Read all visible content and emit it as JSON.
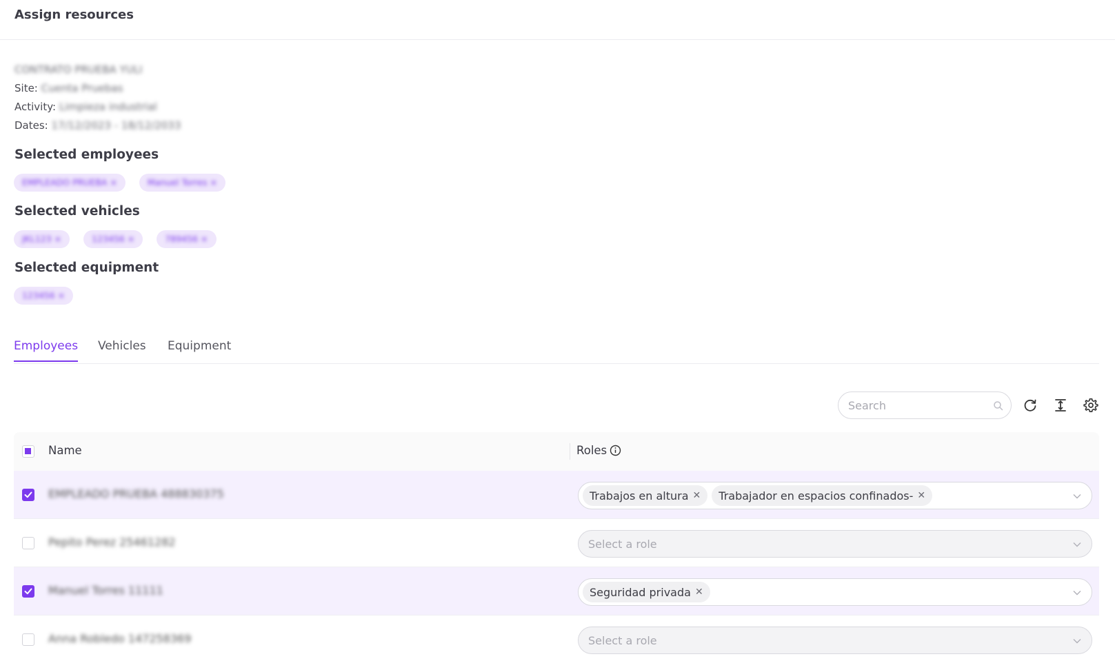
{
  "header": {
    "title": "Assign resources"
  },
  "contract": {
    "name": "CONTRATO PRUEBA YULI",
    "site_label": "Site:",
    "site_value": "Cuenta Pruebas",
    "activity_label": "Activity:",
    "activity_value": "Limpieza industrial",
    "dates_label": "Dates:",
    "dates_value": "17/12/2023 - 18/12/2033"
  },
  "selected_employees": {
    "title": "Selected employees",
    "chips": [
      "EMPLEADO PRUEBA ×",
      "Manuel Torres ×"
    ]
  },
  "selected_vehicles": {
    "title": "Selected vehicles",
    "chips": [
      "JKL123 ×",
      "123456 ×",
      "789456 ×"
    ]
  },
  "selected_equipment": {
    "title": "Selected equipment",
    "chips": [
      "123456 ×"
    ]
  },
  "tabs": [
    {
      "label": "Employees",
      "active": true
    },
    {
      "label": "Vehicles",
      "active": false
    },
    {
      "label": "Equipment",
      "active": false
    }
  ],
  "toolbar": {
    "search_placeholder": "Search",
    "icons": [
      "search-icon",
      "refresh-icon",
      "column-height-icon",
      "settings-icon"
    ]
  },
  "table": {
    "columns": {
      "name": "Name",
      "roles": "Roles"
    },
    "rows": [
      {
        "name": "EMPLEADO PRUEBA 488830375",
        "checked": true,
        "roles": [
          "Trabajos en altura",
          "Trabajador en espacios confinados-"
        ]
      },
      {
        "name": "Pepito Perez 25461282",
        "checked": false,
        "roles": [],
        "placeholder": "Select a role"
      },
      {
        "name": "Manuel Torres 11111",
        "checked": true,
        "roles": [
          "Seguridad privada"
        ]
      },
      {
        "name": "Anna Robledo 147258369",
        "checked": false,
        "roles": [],
        "placeholder": "Select a role"
      }
    ]
  },
  "colors": {
    "accent": "#7c3aed",
    "chip_bg": "#efe6fc",
    "row_selected": "#f5f0fe"
  }
}
